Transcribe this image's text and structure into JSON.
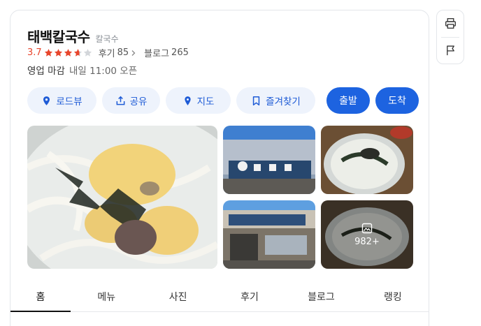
{
  "place": {
    "name": "태백칼국수",
    "category": "칼국수",
    "rating": "3.7",
    "stars_value": 3.7,
    "review_label": "후기",
    "review_count": "85",
    "blog_label": "블로그",
    "blog_count": "265",
    "status": "영업 마감",
    "next_open": "내일 11:00 오픈"
  },
  "actions": {
    "roadview": "로드뷰",
    "share": "공유",
    "map": "지도",
    "favorite": "즐겨찾기",
    "depart": "출발",
    "arrive": "도착"
  },
  "gallery": {
    "more_count": "982+"
  },
  "tabs": [
    "홈",
    "메뉴",
    "사진",
    "후기",
    "블로그",
    "랭킹"
  ],
  "colors": {
    "accent": "#1d63e0",
    "chip_bg": "#eef3fc",
    "star": "#e8452c"
  },
  "icons": [
    "location-pin-icon",
    "share-icon",
    "map-pin-icon",
    "bookmark-icon",
    "print-icon",
    "flag-icon",
    "photo-icon"
  ]
}
